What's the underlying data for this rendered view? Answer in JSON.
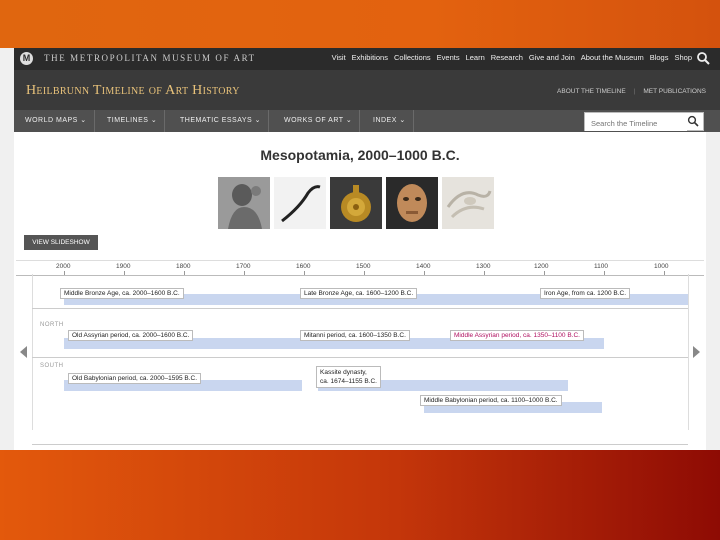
{
  "met_header": {
    "logo": "M",
    "name": "THE METROPOLITAN MUSEUM OF ART",
    "nav": [
      "Visit",
      "Exhibitions",
      "Collections",
      "Events",
      "Learn",
      "Research",
      "Give and Join",
      "About the Museum",
      "Blogs",
      "Shop"
    ],
    "search_icon": "search-icon"
  },
  "heilbrunn_header": {
    "title": "Heilbrunn Timeline of Art History",
    "links": [
      "ABOUT THE TIMELINE",
      "MET PUBLICATIONS"
    ]
  },
  "nav": {
    "items": [
      "WORLD MAPS ⌄",
      "TIMELINES ⌄",
      "THEMATIC ESSAYS ⌄",
      "WORKS OF ART ⌄",
      "INDEX ⌄"
    ],
    "search_placeholder": "Search the Timeline"
  },
  "page": {
    "title": "Mesopotamia, 2000–1000 B.C.",
    "slideshow_label": "VIEW SLIDESHOW"
  },
  "timeline": {
    "ticks": [
      "2000",
      "1900",
      "1800",
      "1700",
      "1600",
      "1500",
      "1400",
      "1300",
      "1200",
      "1100",
      "1000"
    ],
    "regions": {
      "north": "NORTH",
      "south": "SOUTH"
    },
    "periods": {
      "middle_bronze": "Middle Bronze Age, ca. 2000–1600 B.C.",
      "late_bronze": "Late Bronze Age, ca. 1600–1200 B.C.",
      "iron_age": "Iron Age, from ca. 1200 B.C.",
      "old_assyrian": "Old Assyrian period, ca. 2000–1600 B.C.",
      "mitanni": "Mitanni period, ca. 1600–1350 B.C.",
      "middle_assyrian": "Middle Assyrian period, ca. 1350–1100 B.C.",
      "old_babylonian": "Old Babylonian period, ca. 2000–1595 B.C.",
      "kassite_1": "Kassite dynasty,",
      "kassite_2": "ca. 1674–1155 B.C.",
      "middle_babylonian": "Middle Babylonian period, ca. 1100–1000 B.C."
    }
  },
  "colors": {
    "accent_title": "#e8c27a",
    "bar_fill": "#c9d6ef",
    "highlight": "#b01060"
  }
}
